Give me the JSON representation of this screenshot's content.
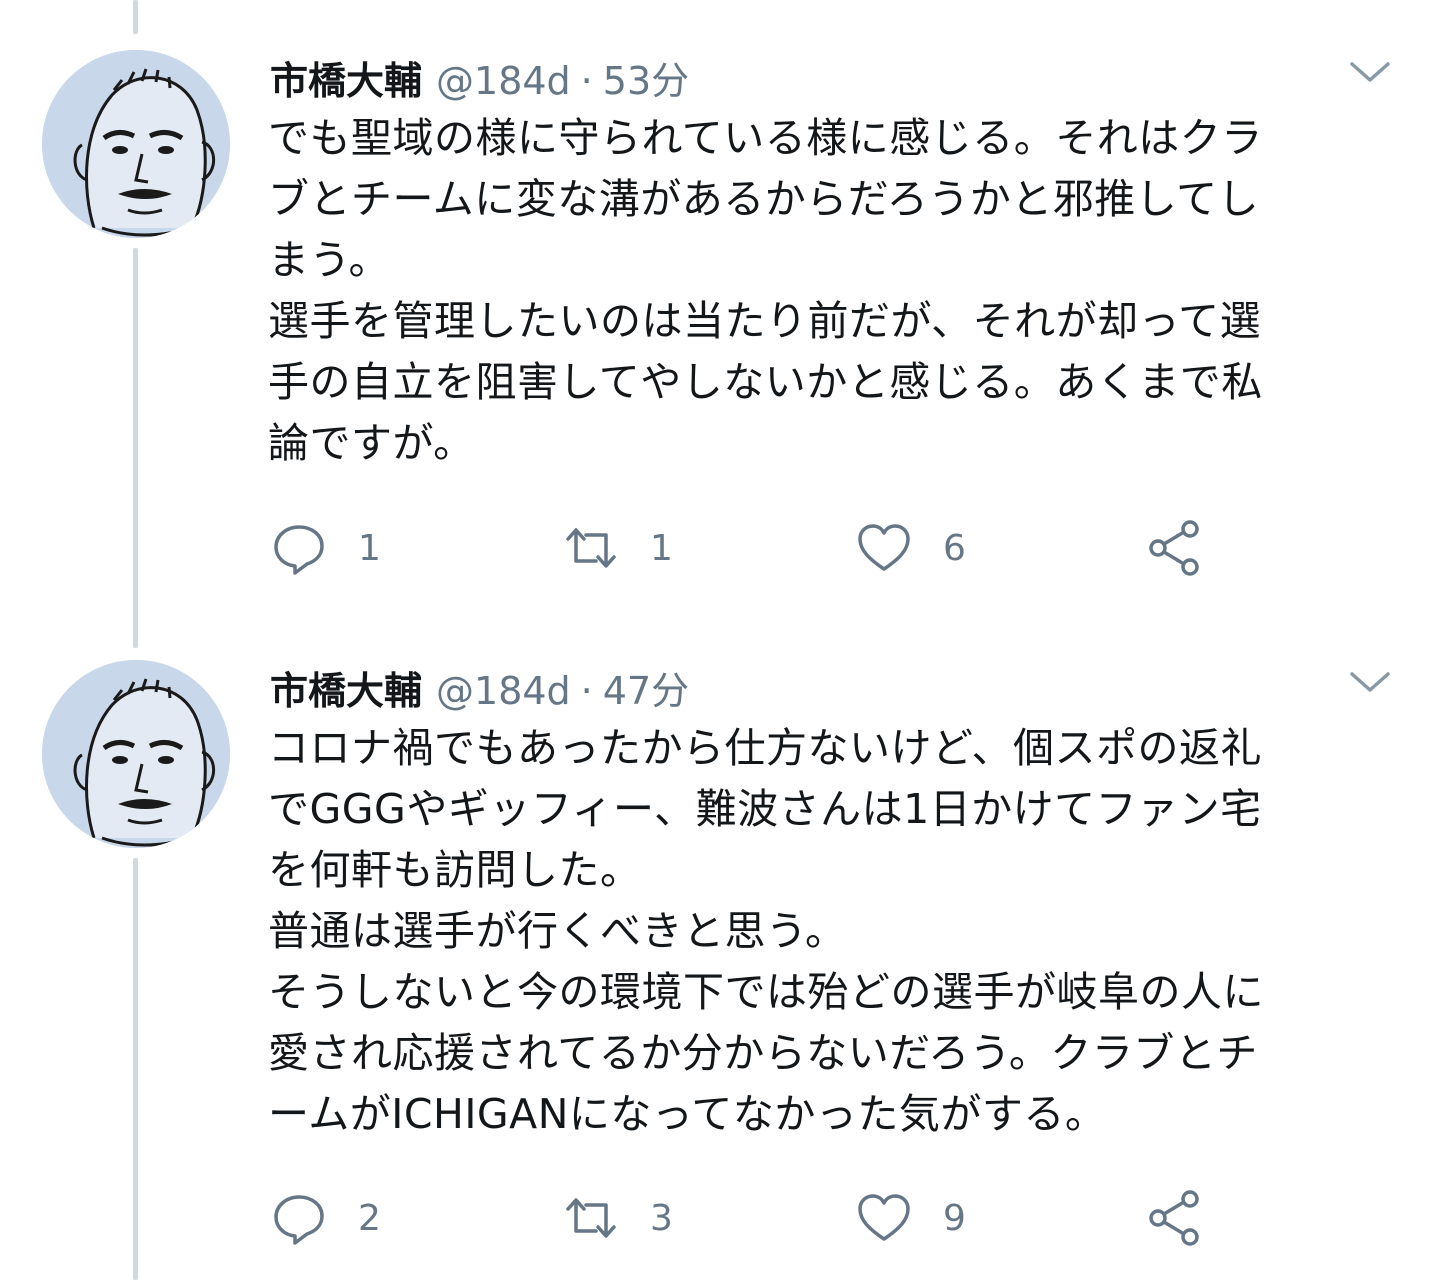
{
  "tweets": [
    {
      "author_name": "市橋大輔",
      "handle": "@184d",
      "separator": "·",
      "time": "53分",
      "text_lines": [
        "でも聖域の様に守られている様に感じる。それはクラ",
        "ブとチームに変な溝があるからだろうかと邪推してし",
        "まう。",
        "選手を管理したいのは当たり前だが、それが却って選",
        "手の自立を阻害してやしないかと感じる。あくまで私",
        "論ですが。"
      ],
      "replies": "1",
      "retweets": "1",
      "likes": "6"
    },
    {
      "author_name": "市橋大輔",
      "handle": "@184d",
      "separator": "·",
      "time": "47分",
      "text_lines": [
        "コロナ禍でもあったから仕方ないけど、個スポの返礼",
        "でGGGやギッフィー、難波さんは1日かけてファン宅",
        "を何軒も訪問した。",
        "普通は選手が行くべきと思う。",
        "そうしないと今の環境下では殆どの選手が岐阜の人に",
        "愛され応援されてるか分からないだろう。クラブとチ",
        "ームがICHIGANになってなかった気がする。"
      ],
      "replies": "2",
      "retweets": "3",
      "likes": "9"
    }
  ],
  "icons": {
    "reply": "reply-icon",
    "retweet": "retweet-icon",
    "like": "heart-icon",
    "share": "share-icon",
    "menu": "chevron-down-icon",
    "avatar": "avatar-illustration"
  },
  "colors": {
    "text": "#14171a",
    "secondary": "#657786",
    "thread_line": "#cfd9de",
    "avatar_bg": "#c9d7ea"
  }
}
